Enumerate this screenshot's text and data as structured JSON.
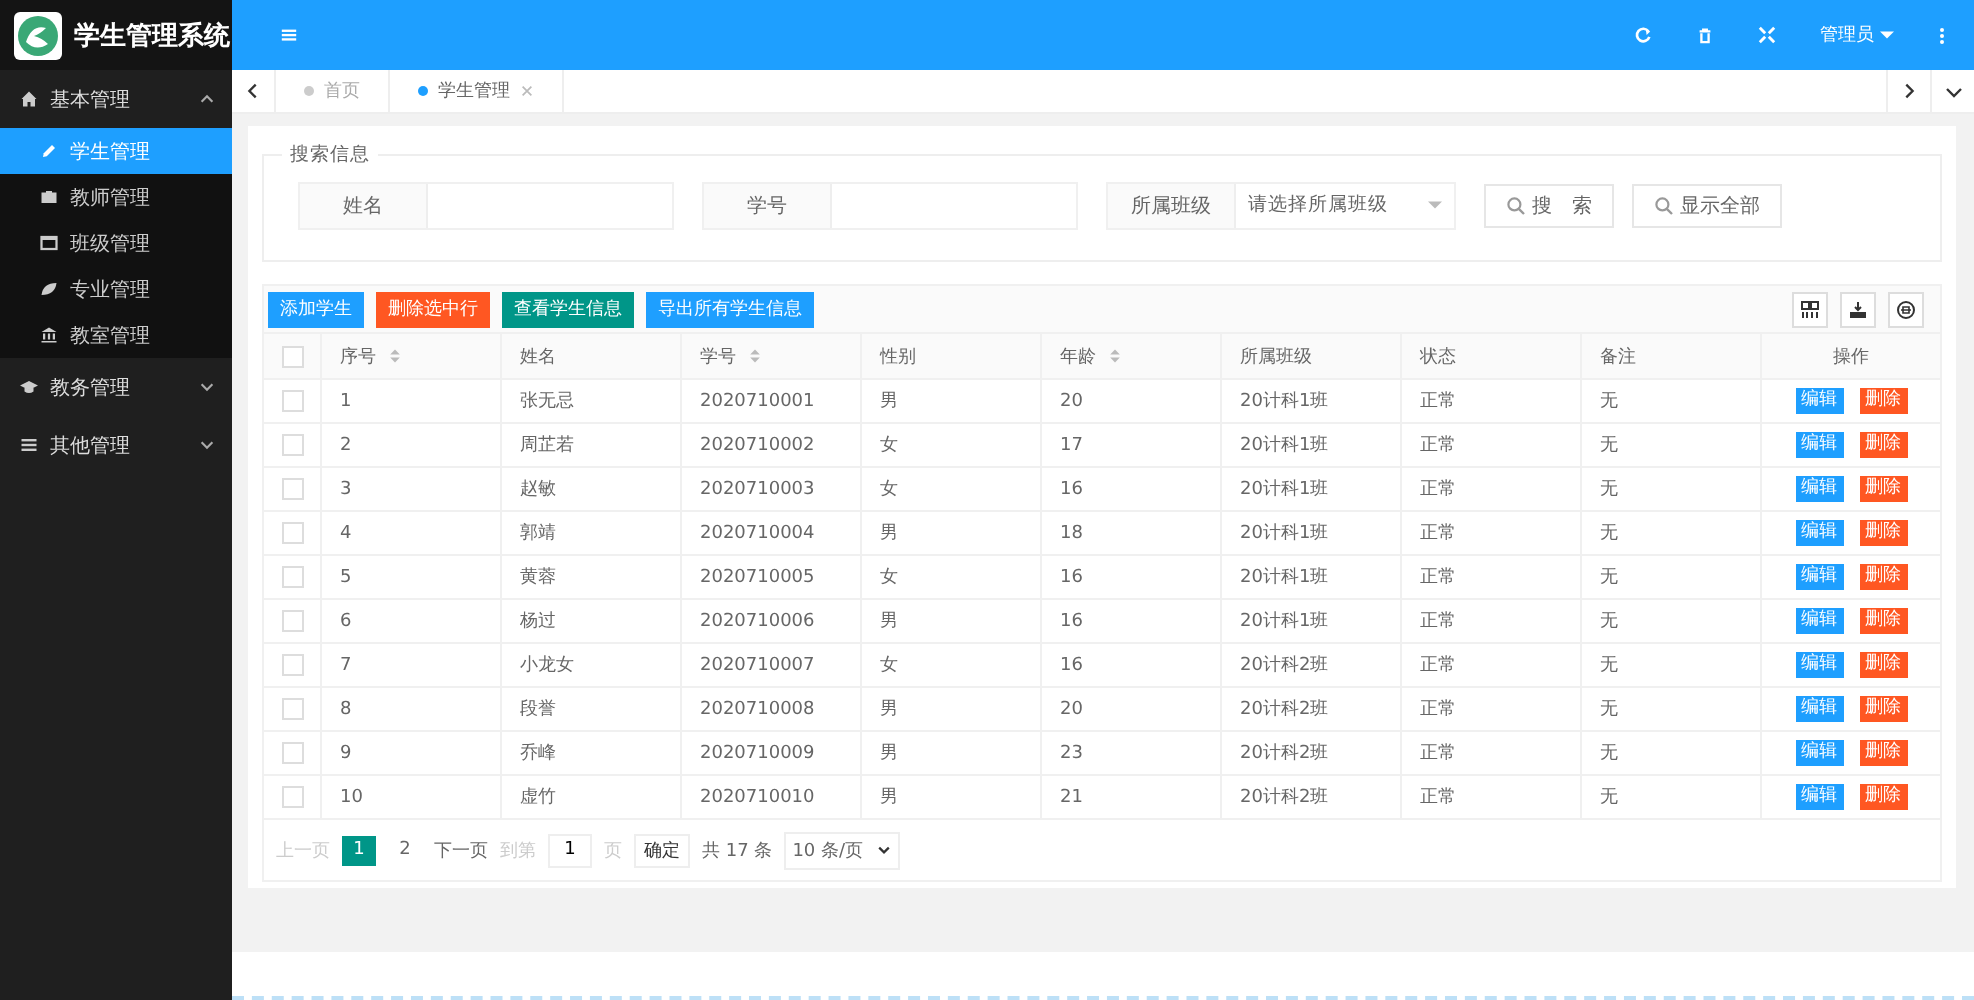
{
  "app": {
    "title": "学生管理系统"
  },
  "header": {
    "user": "管理员"
  },
  "sidebar": {
    "items": [
      {
        "label": "基本管理",
        "expanded": true,
        "children": [
          {
            "label": "学生管理",
            "selected": true
          },
          {
            "label": "教师管理",
            "selected": false
          },
          {
            "label": "班级管理",
            "selected": false
          },
          {
            "label": "专业管理",
            "selected": false
          },
          {
            "label": "教室管理",
            "selected": false
          }
        ]
      },
      {
        "label": "教务管理",
        "expanded": false
      },
      {
        "label": "其他管理",
        "expanded": false
      }
    ]
  },
  "tabs": [
    {
      "label": "首页",
      "selected": false,
      "closable": false
    },
    {
      "label": "学生管理",
      "selected": true,
      "closable": true
    }
  ],
  "search": {
    "legend": "搜索信息",
    "fields": [
      {
        "kind": "text",
        "label": "姓名"
      },
      {
        "kind": "text",
        "label": "学号"
      },
      {
        "kind": "select",
        "label": "所属班级",
        "placeholder": "请选择所属班级"
      }
    ],
    "buttons": [
      "搜　索",
      "显示全部"
    ]
  },
  "toolbar": {
    "buttons": [
      {
        "label": "添加学生",
        "color": "#1e9fff"
      },
      {
        "label": "删除选中行",
        "color": "#ff5722"
      },
      {
        "label": "查看学生信息",
        "color": "#009688"
      },
      {
        "label": "导出所有学生信息",
        "color": "#1e9fff"
      }
    ]
  },
  "table": {
    "all_checked": false,
    "columns": [
      {
        "label": "序号",
        "sortable": true
      },
      {
        "label": "姓名",
        "sortable": false
      },
      {
        "label": "学号",
        "sortable": true
      },
      {
        "label": "性别",
        "sortable": false
      },
      {
        "label": "年龄",
        "sortable": true
      },
      {
        "label": "所属班级",
        "sortable": false
      },
      {
        "label": "状态",
        "sortable": false
      },
      {
        "label": "备注",
        "sortable": false
      },
      {
        "label": "操作",
        "sortable": false
      }
    ],
    "rows": [
      {
        "checked": false,
        "cells": [
          "1",
          "张无忌",
          "2020710001",
          "男",
          "20",
          "20计科1班",
          "正常",
          "无"
        ],
        "actions": [
          "编辑",
          "删除"
        ]
      },
      {
        "checked": false,
        "cells": [
          "2",
          "周芷若",
          "2020710002",
          "女",
          "17",
          "20计科1班",
          "正常",
          "无"
        ],
        "actions": [
          "编辑",
          "删除"
        ]
      },
      {
        "checked": false,
        "cells": [
          "3",
          "赵敏",
          "2020710003",
          "女",
          "16",
          "20计科1班",
          "正常",
          "无"
        ],
        "actions": [
          "编辑",
          "删除"
        ]
      },
      {
        "checked": false,
        "cells": [
          "4",
          "郭靖",
          "2020710004",
          "男",
          "18",
          "20计科1班",
          "正常",
          "无"
        ],
        "actions": [
          "编辑",
          "删除"
        ]
      },
      {
        "checked": false,
        "cells": [
          "5",
          "黄蓉",
          "2020710005",
          "女",
          "16",
          "20计科1班",
          "正常",
          "无"
        ],
        "actions": [
          "编辑",
          "删除"
        ]
      },
      {
        "checked": false,
        "cells": [
          "6",
          "杨过",
          "2020710006",
          "男",
          "16",
          "20计科1班",
          "正常",
          "无"
        ],
        "actions": [
          "编辑",
          "删除"
        ]
      },
      {
        "checked": false,
        "cells": [
          "7",
          "小龙女",
          "2020710007",
          "女",
          "16",
          "20计科2班",
          "正常",
          "无"
        ],
        "actions": [
          "编辑",
          "删除"
        ]
      },
      {
        "checked": false,
        "cells": [
          "8",
          "段誉",
          "2020710008",
          "男",
          "20",
          "20计科2班",
          "正常",
          "无"
        ],
        "actions": [
          "编辑",
          "删除"
        ]
      },
      {
        "checked": false,
        "cells": [
          "9",
          "乔峰",
          "2020710009",
          "男",
          "23",
          "20计科2班",
          "正常",
          "无"
        ],
        "actions": [
          "编辑",
          "删除"
        ]
      },
      {
        "checked": false,
        "cells": [
          "10",
          "虚竹",
          "2020710010",
          "男",
          "21",
          "20计科2班",
          "正常",
          "无"
        ],
        "actions": [
          "编辑",
          "删除"
        ]
      }
    ]
  },
  "pagination": {
    "prev": "上一页",
    "prev_disabled": true,
    "pages": [
      {
        "label": "1",
        "selected": true
      },
      {
        "label": "2",
        "selected": false
      }
    ],
    "next": "下一页",
    "goto": "到第",
    "page_input": "1",
    "page_unit": "页",
    "confirm": "确定",
    "total": "共 17 条",
    "page_size": "10 条/页"
  }
}
